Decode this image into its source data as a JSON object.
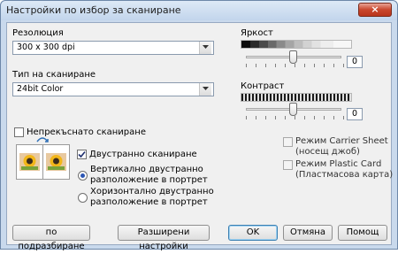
{
  "window": {
    "title": "Настройки по избор за сканиране",
    "close_label": "×"
  },
  "resolution": {
    "label": "Резолюция",
    "value": "300 x 300 dpi"
  },
  "scan_type": {
    "label": "Тип на сканиране",
    "value": "24bit Color"
  },
  "brightness": {
    "label": "Яркост",
    "value": "0",
    "level": 0.5
  },
  "contrast": {
    "label": "Контраст",
    "value": "0",
    "level": 0.5
  },
  "continuous_scan": {
    "label": "Непрекъснато сканиране",
    "checked": false
  },
  "duplex": {
    "label": "Двустранно сканиране",
    "checked": true,
    "options": [
      {
        "line1": "Вертикално двустранно",
        "line2": "разположение в портрет",
        "selected": true
      },
      {
        "line1": "Хоризонтално двустранно",
        "line2": "разположение в портрет",
        "selected": false
      }
    ]
  },
  "carrier_sheet": {
    "line1": "Режим Carrier Sheet",
    "line2": "(носещ джоб)",
    "checked": false,
    "enabled": false
  },
  "plastic_card": {
    "line1": "Режим Plastic Card",
    "line2": "(Пластмасова карта)",
    "checked": false,
    "enabled": false
  },
  "buttons": {
    "default": "по подразбиране",
    "advanced": "Разширени настройки",
    "ok": "OK",
    "cancel": "Отмяна",
    "help": "Помощ"
  },
  "colors": {
    "titlebar": "#c9d9ec",
    "radio_dot": "#2c56b4",
    "close_red": "#c9462c"
  },
  "icons": [
    "close-icon",
    "dropdown-arrow-icon",
    "checkmark-icon",
    "duplex-flower-image-icon",
    "duplex-arrows-icon"
  ]
}
